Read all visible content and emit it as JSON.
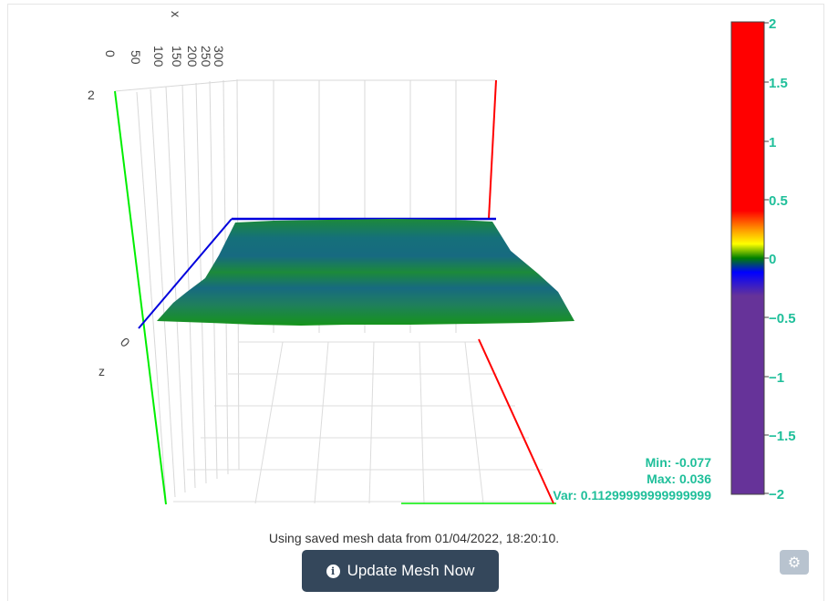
{
  "plot": {
    "x_ticks": [
      "0",
      "50",
      "100",
      "150",
      "200",
      "250",
      "300"
    ],
    "x_axis_title": "x",
    "z_ticks": [
      "2",
      "0"
    ],
    "z_axis_title": "z",
    "colors": {
      "x_axis": "#0000dd",
      "y_axis": "#ff0000",
      "z_axis": "#00ee00"
    }
  },
  "colorbar": {
    "ticks": [
      "2",
      "1.5",
      "1",
      "0.5",
      "0",
      "−0.5",
      "−1",
      "−1.5",
      "−2"
    ],
    "colors": {
      "high": "#ff0000",
      "mid_low": "#0000ff",
      "low": "#663399",
      "zero": "#008000"
    }
  },
  "stats": {
    "min": "Min: -0.077",
    "max": "Max: 0.036",
    "var": "Var: 0.11299999999999999"
  },
  "status_text": "Using saved mesh data from 01/04/2022, 18:20:10.",
  "update_button": {
    "label": "Update Mesh Now",
    "icon": "info-circle-icon"
  },
  "settings_button": {
    "icon": "gear-icon"
  }
}
